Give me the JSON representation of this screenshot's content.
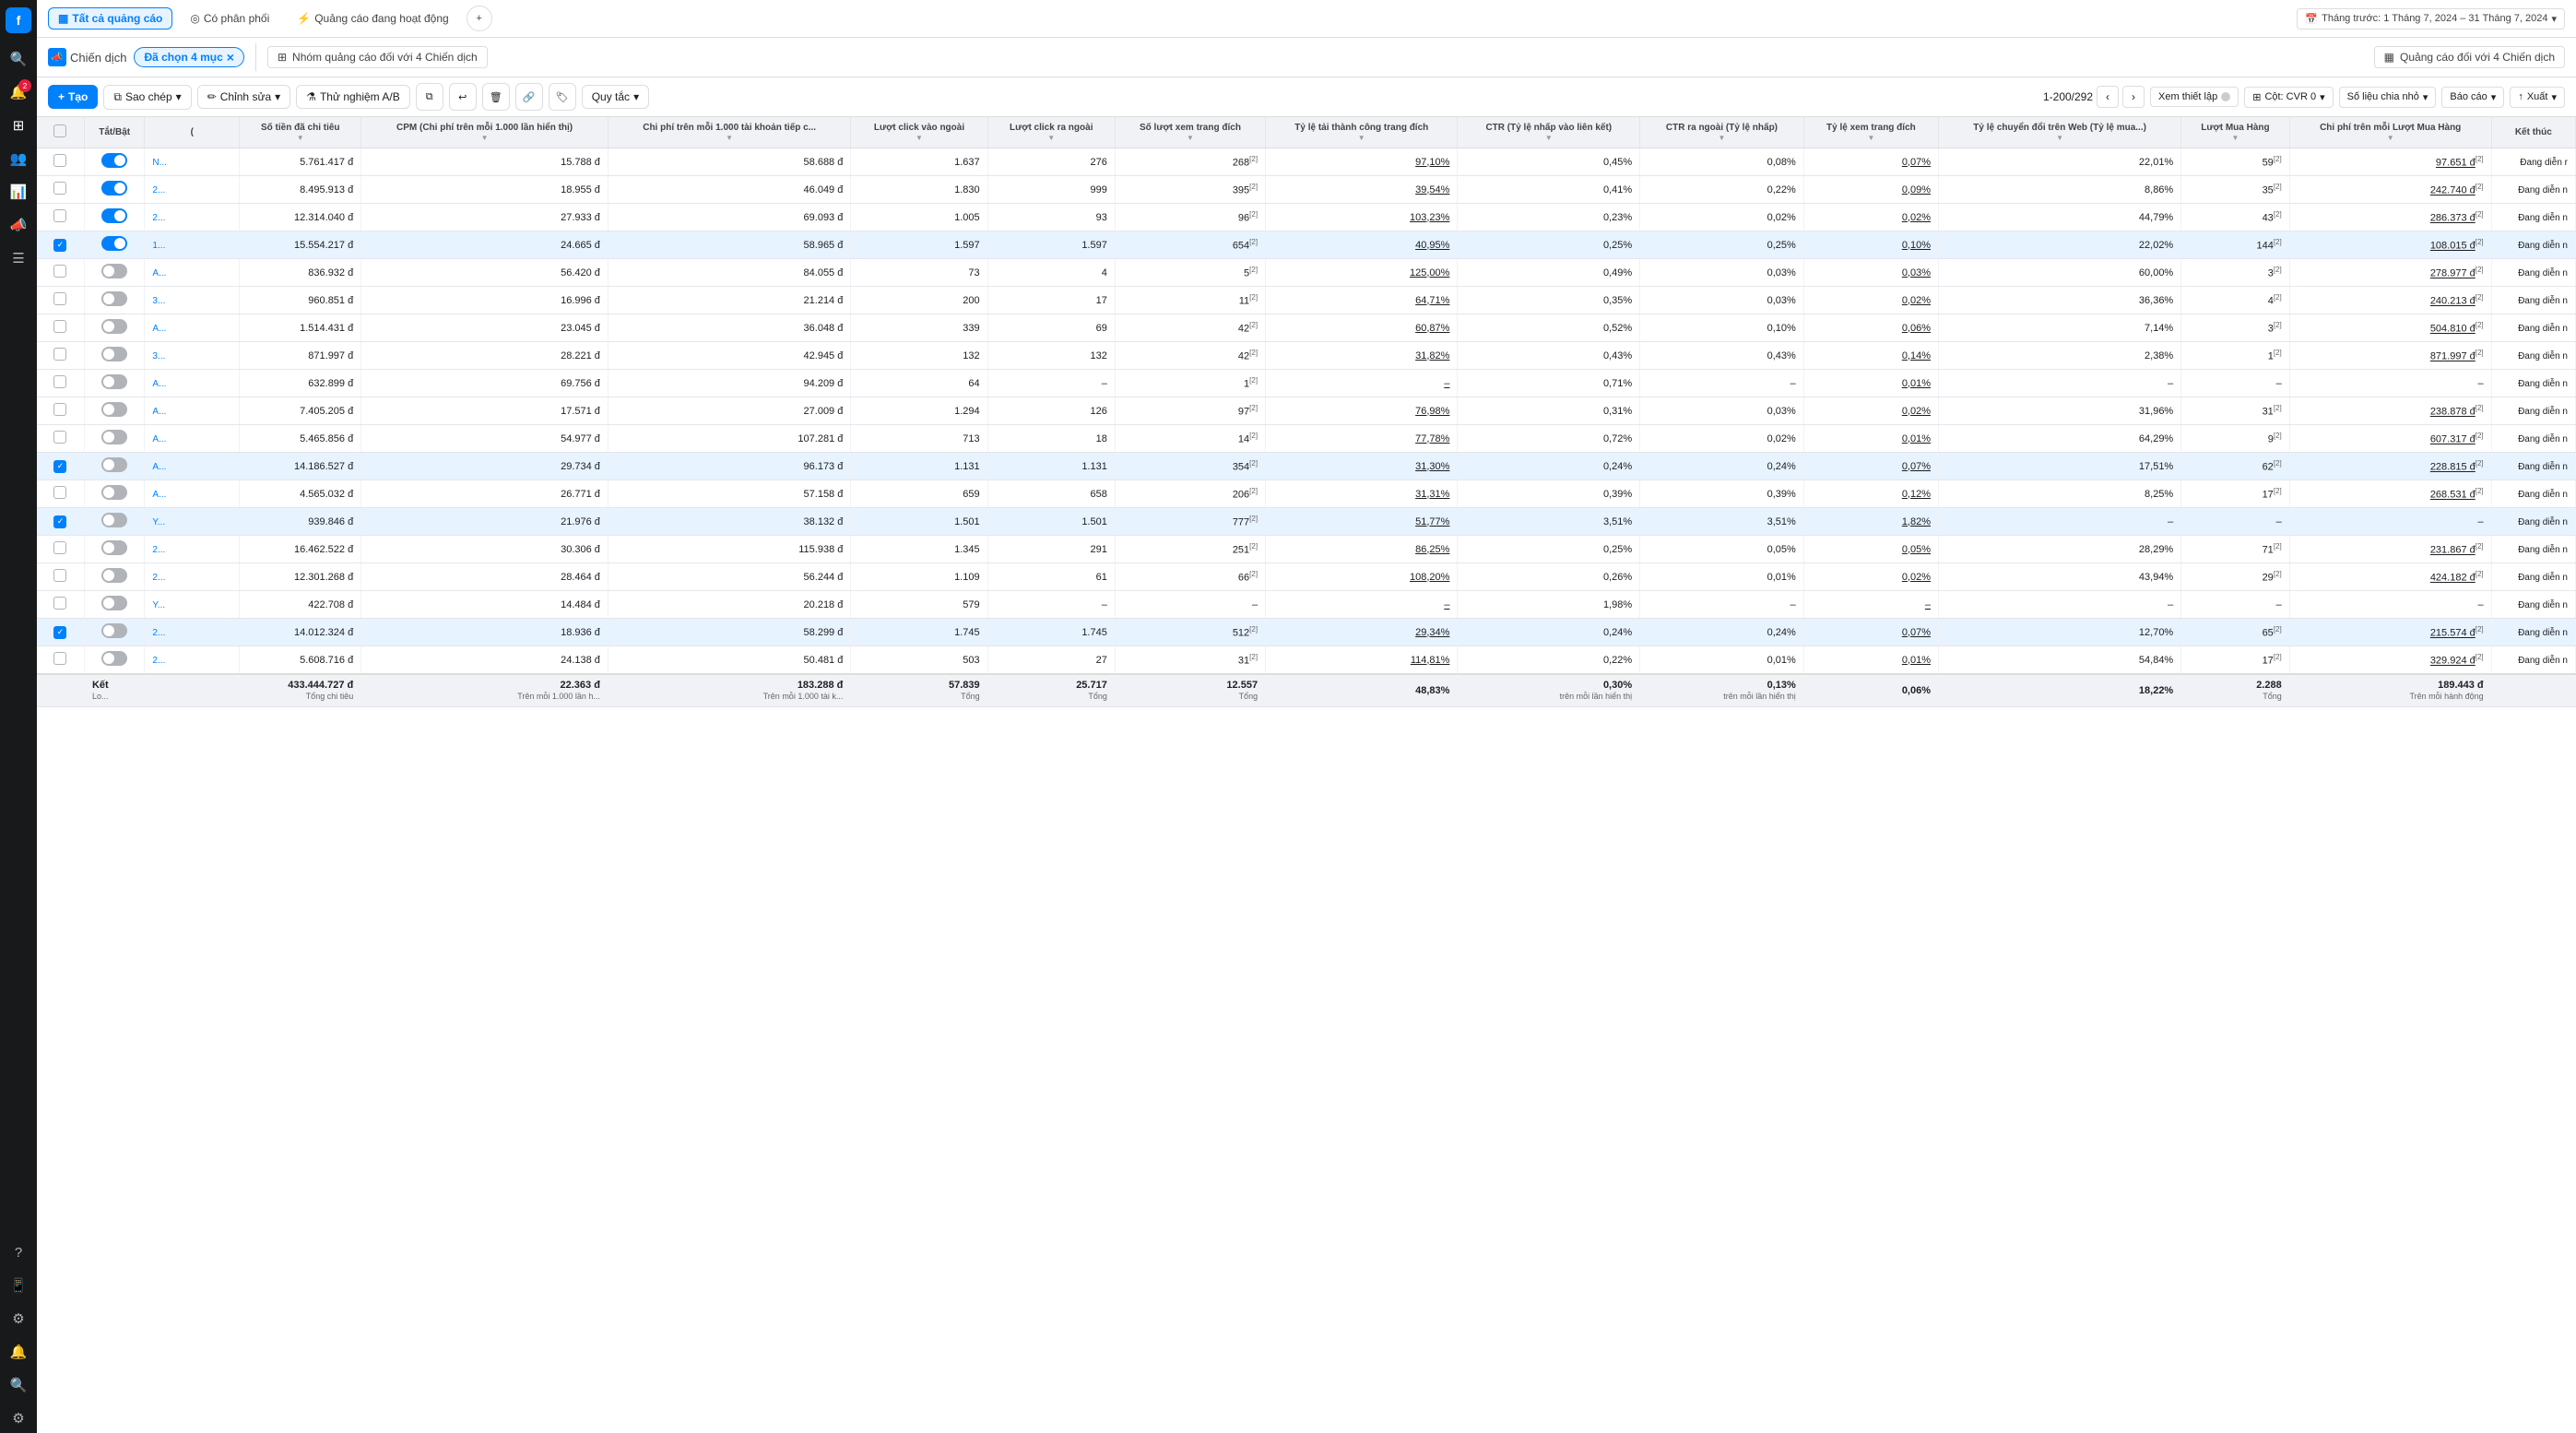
{
  "sidebar": {
    "logo": "f",
    "items": [
      {
        "name": "search",
        "icon": "🔍"
      },
      {
        "name": "notifications",
        "icon": "🔔",
        "badge": "2"
      },
      {
        "name": "grid",
        "icon": "⊞"
      },
      {
        "name": "users",
        "icon": "👥"
      },
      {
        "name": "chart",
        "icon": "📊"
      },
      {
        "name": "megaphone",
        "icon": "📣"
      },
      {
        "name": "lines",
        "icon": "☰"
      },
      {
        "name": "help",
        "icon": "?"
      },
      {
        "name": "phone",
        "icon": "📱"
      },
      {
        "name": "settings",
        "icon": "⚙"
      },
      {
        "name": "bell",
        "icon": "🔔"
      },
      {
        "name": "search2",
        "icon": "🔍"
      },
      {
        "name": "gear2",
        "icon": "⚙"
      }
    ]
  },
  "topbar": {
    "tabs": [
      {
        "label": "Tất cả quảng cáo",
        "active": true,
        "icon": "▦"
      },
      {
        "label": "Có phân phối",
        "active": false,
        "icon": "◎"
      },
      {
        "label": "Quảng cáo đang hoạt động",
        "active": false,
        "icon": "⚡"
      }
    ],
    "add_icon": "+",
    "date_range": "Tháng trước: 1 Tháng 7, 2024 – 31 Tháng 7, 2024"
  },
  "subheader": {
    "campaign_label": "Chiến dịch",
    "selected_badge": "Đã chọn 4 mục",
    "ad_group": "Nhóm quảng cáo đối với 4 Chiến dịch",
    "ad_label": "Quảng cáo đối với 4 Chiến dịch"
  },
  "toolbar": {
    "create": "Tạo",
    "copy": "Sao chép",
    "edit": "Chỉnh sửa",
    "ab_test": "Thử nghiệm A/B",
    "rules": "Quy tắc",
    "pagination": "1-200/292",
    "view_settings": "Xem thiết lập",
    "col_setting": "Cột: CVR 0",
    "data_small": "Số liệu chia nhỏ",
    "report": "Báo cáo",
    "export": "Xuất"
  },
  "table": {
    "columns": [
      "Tắt/Bật",
      "(",
      "Số tiền đã chi tiêu",
      "CPM (Chi phí trên mỗi 1.000 lần hiển thị)",
      "Chi phí trên mỗi 1.000 tài khoản tiếp c...",
      "Lượt click vào ngoài",
      "Lượt click ra ngoài",
      "Số lượt xem trang đích",
      "Tỷ lệ tải thành công trang đích",
      "CTR (Tỷ lệ nhấp vào liên kết)",
      "CTR ra ngoài (Tỷ lệ nhấp)",
      "Tỷ lệ xem trang đích",
      "Tỷ lệ chuyển đổi trên Web (Tỷ lệ mua...)",
      "Lượt Mua Hàng",
      "Chi phí trên mỗi Lượt Mua Hàng",
      "Kết thúc"
    ],
    "rows": [
      {
        "check": false,
        "toggle": true,
        "name": "N...",
        "spend": "5.761.417 đ",
        "cpm": "15.788 đ",
        "cpp": "58.688 đ",
        "clicks_in": "1.637",
        "clicks_out": "276",
        "views": "268",
        "load_rate": "97,10%",
        "ctr_link": "0,45%",
        "ctr_out": "0,08%",
        "view_rate": "0,07%",
        "cvr": "22,01%",
        "purchases": "59",
        "cpp2": "97.651 đ",
        "status": "Đang diễn r",
        "selected": false
      },
      {
        "check": false,
        "toggle": true,
        "name": "2...",
        "spend": "8.495.913 đ",
        "cpm": "18.955 đ",
        "cpp": "46.049 đ",
        "clicks_in": "1.830",
        "clicks_out": "999",
        "views": "395",
        "load_rate": "39,54%",
        "ctr_link": "0,41%",
        "ctr_out": "0,22%",
        "view_rate": "0,09%",
        "cvr": "8,86%",
        "purchases": "35",
        "cpp2": "242.740 đ",
        "status": "Đang diễn n",
        "selected": false
      },
      {
        "check": false,
        "toggle": true,
        "name": "2...",
        "spend": "12.314.040 đ",
        "cpm": "27.933 đ",
        "cpp": "69.093 đ",
        "clicks_in": "1.005",
        "clicks_out": "93",
        "views": "96",
        "load_rate": "103,23%",
        "ctr_link": "0,23%",
        "ctr_out": "0,02%",
        "view_rate": "0,02%",
        "cvr": "44,79%",
        "purchases": "43",
        "cpp2": "286.373 đ",
        "status": "Đang diễn n",
        "selected": false
      },
      {
        "check": true,
        "toggle": true,
        "name": "1...",
        "spend": "15.554.217 đ",
        "cpm": "24.665 đ",
        "cpp": "58.965 đ",
        "clicks_in": "1.597",
        "clicks_out": "1.597",
        "views": "654",
        "load_rate": "40,95%",
        "ctr_link": "0,25%",
        "ctr_out": "0,25%",
        "view_rate": "0,10%",
        "cvr": "22,02%",
        "purchases": "144",
        "cpp2": "108.015 đ",
        "status": "Đang diễn n",
        "selected": true
      },
      {
        "check": false,
        "toggle": false,
        "name": "A...",
        "spend": "836.932 đ",
        "cpm": "56.420 đ",
        "cpp": "84.055 đ",
        "clicks_in": "73",
        "clicks_out": "4",
        "views": "5",
        "load_rate": "125,00%",
        "ctr_link": "0,49%",
        "ctr_out": "0,03%",
        "view_rate": "0,03%",
        "cvr": "60,00%",
        "purchases": "3",
        "cpp2": "278.977 đ",
        "status": "Đang diễn n",
        "selected": false
      },
      {
        "check": false,
        "toggle": false,
        "name": "3...",
        "spend": "960.851 đ",
        "cpm": "16.996 đ",
        "cpp": "21.214 đ",
        "clicks_in": "200",
        "clicks_out": "17",
        "views": "11",
        "load_rate": "64,71%",
        "ctr_link": "0,35%",
        "ctr_out": "0,03%",
        "view_rate": "0,02%",
        "cvr": "36,36%",
        "purchases": "4",
        "cpp2": "240.213 đ",
        "status": "Đang diễn n",
        "selected": false
      },
      {
        "check": false,
        "toggle": false,
        "name": "A...",
        "spend": "1.514.431 đ",
        "cpm": "23.045 đ",
        "cpp": "36.048 đ",
        "clicks_in": "339",
        "clicks_out": "69",
        "views": "42",
        "load_rate": "60,87%",
        "ctr_link": "0,52%",
        "ctr_out": "0,10%",
        "view_rate": "0,06%",
        "cvr": "7,14%",
        "purchases": "3",
        "cpp2": "504.810 đ",
        "status": "Đang diễn n",
        "selected": false
      },
      {
        "check": false,
        "toggle": false,
        "name": "3...",
        "spend": "871.997 đ",
        "cpm": "28.221 đ",
        "cpp": "42.945 đ",
        "clicks_in": "132",
        "clicks_out": "132",
        "views": "42",
        "load_rate": "31,82%",
        "ctr_link": "0,43%",
        "ctr_out": "0,43%",
        "view_rate": "0,14%",
        "cvr": "2,38%",
        "purchases": "1",
        "cpp2": "871.997 đ",
        "status": "Đang diễn n",
        "selected": false
      },
      {
        "check": false,
        "toggle": false,
        "name": "A...",
        "spend": "632.899 đ",
        "cpm": "69.756 đ",
        "cpp": "94.209 đ",
        "clicks_in": "64",
        "clicks_out": "–",
        "views": "1",
        "load_rate": "–",
        "ctr_link": "0,71%",
        "ctr_out": "–",
        "view_rate": "0,01%",
        "cvr": "–",
        "purchases": "–",
        "cpp2": "–",
        "status": "Đang diễn n",
        "selected": false
      },
      {
        "check": false,
        "toggle": false,
        "name": "A...",
        "spend": "7.405.205 đ",
        "cpm": "17.571 đ",
        "cpp": "27.009 đ",
        "clicks_in": "1.294",
        "clicks_out": "126",
        "views": "97",
        "load_rate": "76,98%",
        "ctr_link": "0,31%",
        "ctr_out": "0,03%",
        "view_rate": "0,02%",
        "cvr": "31,96%",
        "purchases": "31",
        "cpp2": "238.878 đ",
        "status": "Đang diễn n",
        "selected": false
      },
      {
        "check": false,
        "toggle": false,
        "name": "A...",
        "spend": "5.465.856 đ",
        "cpm": "54.977 đ",
        "cpp": "107.281 đ",
        "clicks_in": "713",
        "clicks_out": "18",
        "views": "14",
        "load_rate": "77,78%",
        "ctr_link": "0,72%",
        "ctr_out": "0,02%",
        "view_rate": "0,01%",
        "cvr": "64,29%",
        "purchases": "9",
        "cpp2": "607.317 đ",
        "status": "Đang diễn n",
        "selected": false
      },
      {
        "check": true,
        "toggle": false,
        "name": "A...",
        "spend": "14.186.527 đ",
        "cpm": "29.734 đ",
        "cpp": "96.173 đ",
        "clicks_in": "1.131",
        "clicks_out": "1.131",
        "views": "354",
        "load_rate": "31,30%",
        "ctr_link": "0,24%",
        "ctr_out": "0,24%",
        "view_rate": "0,07%",
        "cvr": "17,51%",
        "purchases": "62",
        "cpp2": "228.815 đ",
        "status": "Đang diễn n",
        "selected": true
      },
      {
        "check": false,
        "toggle": false,
        "name": "A...",
        "spend": "4.565.032 đ",
        "cpm": "26.771 đ",
        "cpp": "57.158 đ",
        "clicks_in": "659",
        "clicks_out": "658",
        "views": "206",
        "load_rate": "31,31%",
        "ctr_link": "0,39%",
        "ctr_out": "0,39%",
        "view_rate": "0,12%",
        "cvr": "8,25%",
        "purchases": "17",
        "cpp2": "268.531 đ",
        "status": "Đang diễn n",
        "selected": false
      },
      {
        "check": true,
        "toggle": false,
        "name": "Y...",
        "spend": "939.846 đ",
        "cpm": "21.976 đ",
        "cpp": "38.132 đ",
        "clicks_in": "1.501",
        "clicks_out": "1.501",
        "views": "777",
        "load_rate": "51,77%",
        "ctr_link": "3,51%",
        "ctr_out": "3,51%",
        "view_rate": "1,82%",
        "cvr": "–",
        "purchases": "–",
        "cpp2": "–",
        "status": "Đang diễn n",
        "selected": true
      },
      {
        "check": false,
        "toggle": false,
        "name": "2...",
        "spend": "16.462.522 đ",
        "cpm": "30.306 đ",
        "cpp": "115.938 đ",
        "clicks_in": "1.345",
        "clicks_out": "291",
        "views": "251",
        "load_rate": "86,25%",
        "ctr_link": "0,25%",
        "ctr_out": "0,05%",
        "view_rate": "0,05%",
        "cvr": "28,29%",
        "purchases": "71",
        "cpp2": "231.867 đ",
        "status": "Đang diễn n",
        "selected": false
      },
      {
        "check": false,
        "toggle": false,
        "name": "2...",
        "spend": "12.301.268 đ",
        "cpm": "28.464 đ",
        "cpp": "56.244 đ",
        "clicks_in": "1.109",
        "clicks_out": "61",
        "views": "66",
        "load_rate": "108,20%",
        "ctr_link": "0,26%",
        "ctr_out": "0,01%",
        "view_rate": "0,02%",
        "cvr": "43,94%",
        "purchases": "29",
        "cpp2": "424.182 đ",
        "status": "Đang diễn n",
        "selected": false
      },
      {
        "check": false,
        "toggle": false,
        "name": "Y...",
        "spend": "422.708 đ",
        "cpm": "14.484 đ",
        "cpp": "20.218 đ",
        "clicks_in": "579",
        "clicks_out": "–",
        "views": "–",
        "load_rate": "–",
        "ctr_link": "1,98%",
        "ctr_out": "–",
        "view_rate": "–",
        "cvr": "–",
        "purchases": "–",
        "cpp2": "–",
        "status": "Đang diễn n",
        "selected": false
      },
      {
        "check": true,
        "toggle": false,
        "name": "2...",
        "spend": "14.012.324 đ",
        "cpm": "18.936 đ",
        "cpp": "58.299 đ",
        "clicks_in": "1.745",
        "clicks_out": "1.745",
        "views": "512",
        "load_rate": "29,34%",
        "ctr_link": "0,24%",
        "ctr_out": "0,24%",
        "view_rate": "0,07%",
        "cvr": "12,70%",
        "purchases": "65",
        "cpp2": "215.574 đ",
        "status": "Đang diễn n",
        "selected": true
      },
      {
        "check": false,
        "toggle": false,
        "name": "2...",
        "spend": "5.608.716 đ",
        "cpm": "24.138 đ",
        "cpp": "50.481 đ",
        "clicks_in": "503",
        "clicks_out": "27",
        "views": "31",
        "load_rate": "114,81%",
        "ctr_link": "0,22%",
        "ctr_out": "0,01%",
        "view_rate": "0,01%",
        "cvr": "54,84%",
        "purchases": "17",
        "cpp2": "329.924 đ",
        "status": "Đang diễn n",
        "selected": false
      }
    ],
    "footer": {
      "label": "Kết",
      "sub": "Lo...",
      "spend": "433.444.727 đ",
      "spend_sub": "Tổng chi tiêu",
      "cpm": "22.363 đ",
      "cpm_sub": "Trên mỗi 1.000 lần h...",
      "cpp": "183.288 đ",
      "cpp_sub": "Trên mỗi 1.000 tài k...",
      "clicks_in": "57.839",
      "clicks_in_sub": "Tổng",
      "clicks_out": "25.717",
      "clicks_out_sub": "Tổng",
      "views": "12.557",
      "views_sub": "Tổng",
      "load_rate": "48,83%",
      "ctr_link": "0,30%",
      "ctr_link_sub": "trên mỗi lần hiển thị",
      "ctr_out": "0,13%",
      "ctr_out_sub": "trên mỗi lần hiển thị",
      "view_rate": "0,06%",
      "cvr": "18,22%",
      "purchases": "2.288",
      "purchases_sub": "Tổng",
      "cpp2": "189.443 đ",
      "cpp2_sub": "Trên mỗi hành động"
    }
  }
}
